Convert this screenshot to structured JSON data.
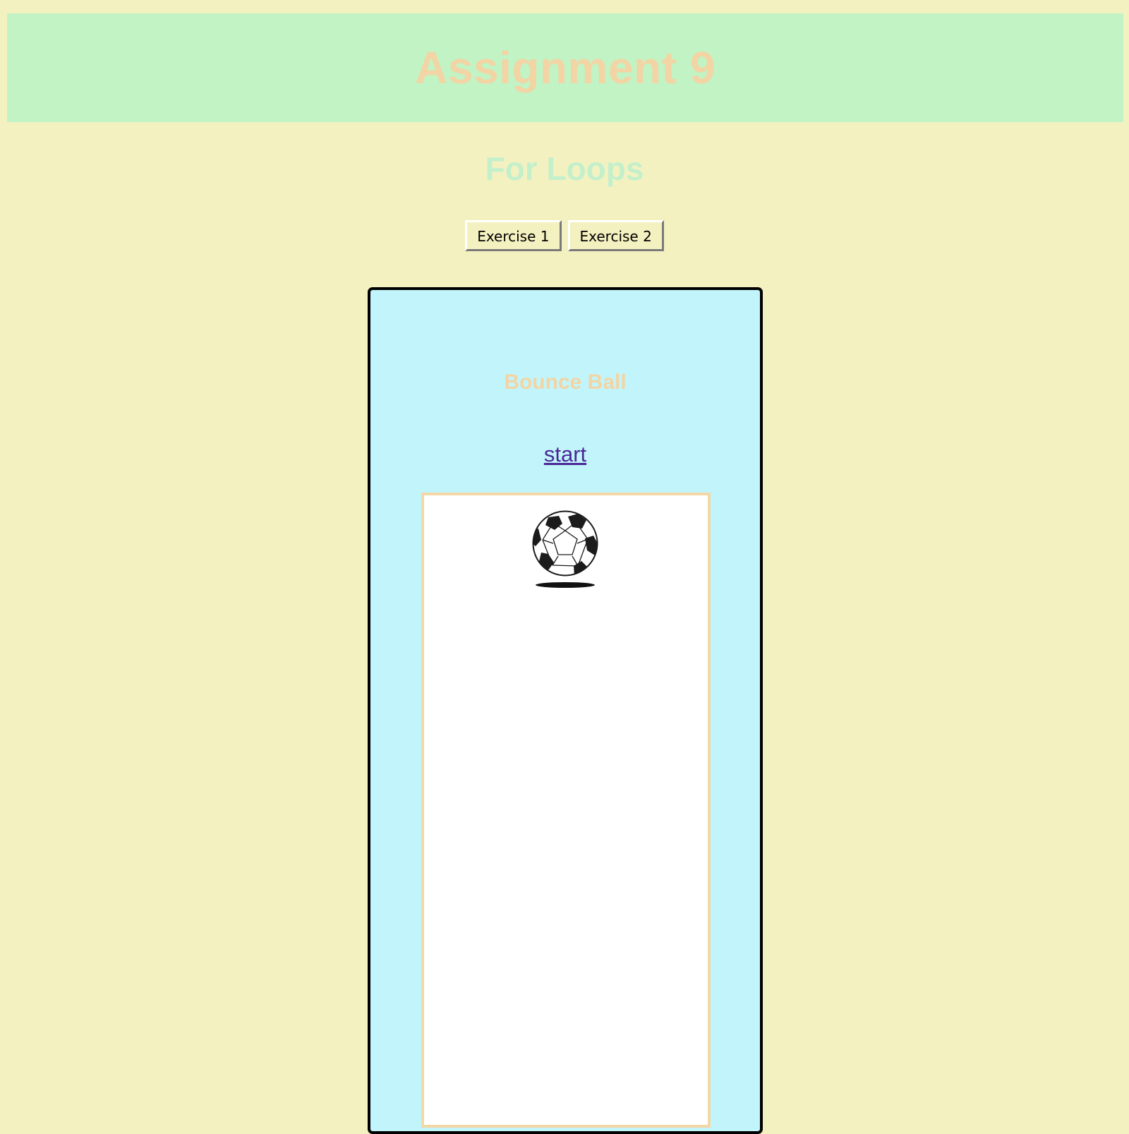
{
  "header": {
    "title": "Assignment 9"
  },
  "page": {
    "subtitle": "For Loops"
  },
  "nav": {
    "buttons": [
      {
        "label": "Exercise 1"
      },
      {
        "label": "Exercise 2"
      }
    ]
  },
  "exercise": {
    "title": "Bounce Ball",
    "start_label": "start",
    "ball_icon": "soccer-ball-icon"
  },
  "colors": {
    "background": "#f4f1c1",
    "header_bg": "#c1f3c5",
    "title_color": "#f3d4a4",
    "subtitle_color": "#c3f0cb",
    "panel_bg": "#c1f5fb",
    "stage_border": "#f3d8a6",
    "link_color": "#4b2897"
  }
}
